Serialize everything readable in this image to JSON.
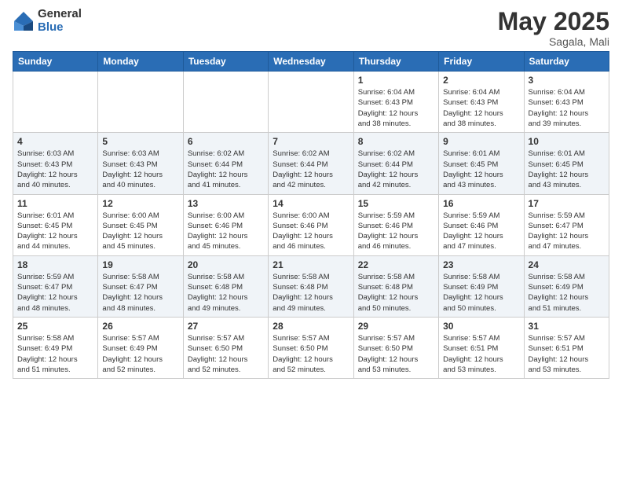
{
  "header": {
    "logo_general": "General",
    "logo_blue": "Blue",
    "title": "May 2025",
    "location": "Sagala, Mali"
  },
  "days_of_week": [
    "Sunday",
    "Monday",
    "Tuesday",
    "Wednesday",
    "Thursday",
    "Friday",
    "Saturday"
  ],
  "weeks": [
    [
      {
        "day": "",
        "info": ""
      },
      {
        "day": "",
        "info": ""
      },
      {
        "day": "",
        "info": ""
      },
      {
        "day": "",
        "info": ""
      },
      {
        "day": "1",
        "info": "Sunrise: 6:04 AM\nSunset: 6:43 PM\nDaylight: 12 hours\nand 38 minutes."
      },
      {
        "day": "2",
        "info": "Sunrise: 6:04 AM\nSunset: 6:43 PM\nDaylight: 12 hours\nand 38 minutes."
      },
      {
        "day": "3",
        "info": "Sunrise: 6:04 AM\nSunset: 6:43 PM\nDaylight: 12 hours\nand 39 minutes."
      }
    ],
    [
      {
        "day": "4",
        "info": "Sunrise: 6:03 AM\nSunset: 6:43 PM\nDaylight: 12 hours\nand 40 minutes."
      },
      {
        "day": "5",
        "info": "Sunrise: 6:03 AM\nSunset: 6:43 PM\nDaylight: 12 hours\nand 40 minutes."
      },
      {
        "day": "6",
        "info": "Sunrise: 6:02 AM\nSunset: 6:44 PM\nDaylight: 12 hours\nand 41 minutes."
      },
      {
        "day": "7",
        "info": "Sunrise: 6:02 AM\nSunset: 6:44 PM\nDaylight: 12 hours\nand 42 minutes."
      },
      {
        "day": "8",
        "info": "Sunrise: 6:02 AM\nSunset: 6:44 PM\nDaylight: 12 hours\nand 42 minutes."
      },
      {
        "day": "9",
        "info": "Sunrise: 6:01 AM\nSunset: 6:45 PM\nDaylight: 12 hours\nand 43 minutes."
      },
      {
        "day": "10",
        "info": "Sunrise: 6:01 AM\nSunset: 6:45 PM\nDaylight: 12 hours\nand 43 minutes."
      }
    ],
    [
      {
        "day": "11",
        "info": "Sunrise: 6:01 AM\nSunset: 6:45 PM\nDaylight: 12 hours\nand 44 minutes."
      },
      {
        "day": "12",
        "info": "Sunrise: 6:00 AM\nSunset: 6:45 PM\nDaylight: 12 hours\nand 45 minutes."
      },
      {
        "day": "13",
        "info": "Sunrise: 6:00 AM\nSunset: 6:46 PM\nDaylight: 12 hours\nand 45 minutes."
      },
      {
        "day": "14",
        "info": "Sunrise: 6:00 AM\nSunset: 6:46 PM\nDaylight: 12 hours\nand 46 minutes."
      },
      {
        "day": "15",
        "info": "Sunrise: 5:59 AM\nSunset: 6:46 PM\nDaylight: 12 hours\nand 46 minutes."
      },
      {
        "day": "16",
        "info": "Sunrise: 5:59 AM\nSunset: 6:46 PM\nDaylight: 12 hours\nand 47 minutes."
      },
      {
        "day": "17",
        "info": "Sunrise: 5:59 AM\nSunset: 6:47 PM\nDaylight: 12 hours\nand 47 minutes."
      }
    ],
    [
      {
        "day": "18",
        "info": "Sunrise: 5:59 AM\nSunset: 6:47 PM\nDaylight: 12 hours\nand 48 minutes."
      },
      {
        "day": "19",
        "info": "Sunrise: 5:58 AM\nSunset: 6:47 PM\nDaylight: 12 hours\nand 48 minutes."
      },
      {
        "day": "20",
        "info": "Sunrise: 5:58 AM\nSunset: 6:48 PM\nDaylight: 12 hours\nand 49 minutes."
      },
      {
        "day": "21",
        "info": "Sunrise: 5:58 AM\nSunset: 6:48 PM\nDaylight: 12 hours\nand 49 minutes."
      },
      {
        "day": "22",
        "info": "Sunrise: 5:58 AM\nSunset: 6:48 PM\nDaylight: 12 hours\nand 50 minutes."
      },
      {
        "day": "23",
        "info": "Sunrise: 5:58 AM\nSunset: 6:49 PM\nDaylight: 12 hours\nand 50 minutes."
      },
      {
        "day": "24",
        "info": "Sunrise: 5:58 AM\nSunset: 6:49 PM\nDaylight: 12 hours\nand 51 minutes."
      }
    ],
    [
      {
        "day": "25",
        "info": "Sunrise: 5:58 AM\nSunset: 6:49 PM\nDaylight: 12 hours\nand 51 minutes."
      },
      {
        "day": "26",
        "info": "Sunrise: 5:57 AM\nSunset: 6:49 PM\nDaylight: 12 hours\nand 52 minutes."
      },
      {
        "day": "27",
        "info": "Sunrise: 5:57 AM\nSunset: 6:50 PM\nDaylight: 12 hours\nand 52 minutes."
      },
      {
        "day": "28",
        "info": "Sunrise: 5:57 AM\nSunset: 6:50 PM\nDaylight: 12 hours\nand 52 minutes."
      },
      {
        "day": "29",
        "info": "Sunrise: 5:57 AM\nSunset: 6:50 PM\nDaylight: 12 hours\nand 53 minutes."
      },
      {
        "day": "30",
        "info": "Sunrise: 5:57 AM\nSunset: 6:51 PM\nDaylight: 12 hours\nand 53 minutes."
      },
      {
        "day": "31",
        "info": "Sunrise: 5:57 AM\nSunset: 6:51 PM\nDaylight: 12 hours\nand 53 minutes."
      }
    ]
  ]
}
